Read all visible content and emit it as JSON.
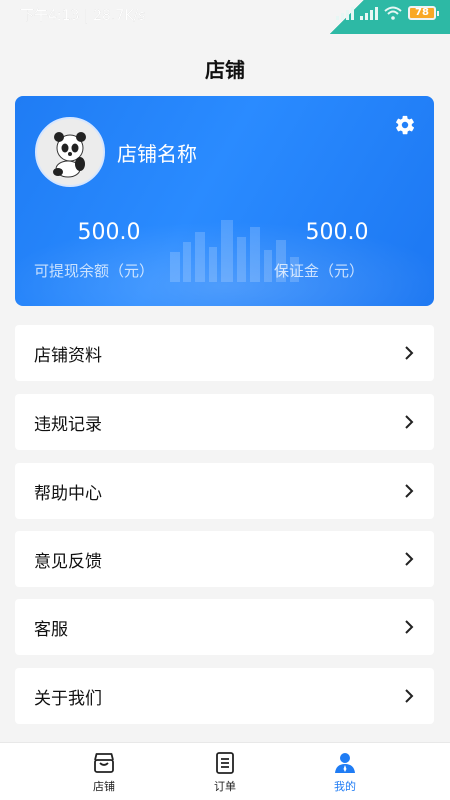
{
  "status_bar": {
    "time_text": "下午4:13 | 28.7K/s",
    "battery": "78"
  },
  "header": {
    "title": "店铺"
  },
  "card": {
    "shop_name": "店铺名称",
    "withdrawable": {
      "value": "500.0",
      "label": "可提现余额（元）"
    },
    "deposit": {
      "value": "500.0",
      "label": "保证金（元）"
    }
  },
  "menu": {
    "items": [
      {
        "label": "店铺资料"
      },
      {
        "label": "违规记录"
      },
      {
        "label": "帮助中心"
      },
      {
        "label": "意见反馈"
      },
      {
        "label": "客服"
      },
      {
        "label": "关于我们"
      }
    ]
  },
  "tabs": [
    {
      "label": "店铺",
      "icon": "store-icon",
      "active": false
    },
    {
      "label": "订单",
      "icon": "order-icon",
      "active": false
    },
    {
      "label": "我的",
      "icon": "user-icon",
      "active": true
    }
  ],
  "colors": {
    "primary": "#1f7cf4",
    "background": "#f4f4f4",
    "status_corner": "#2db9a5",
    "battery": "#f9a826"
  }
}
